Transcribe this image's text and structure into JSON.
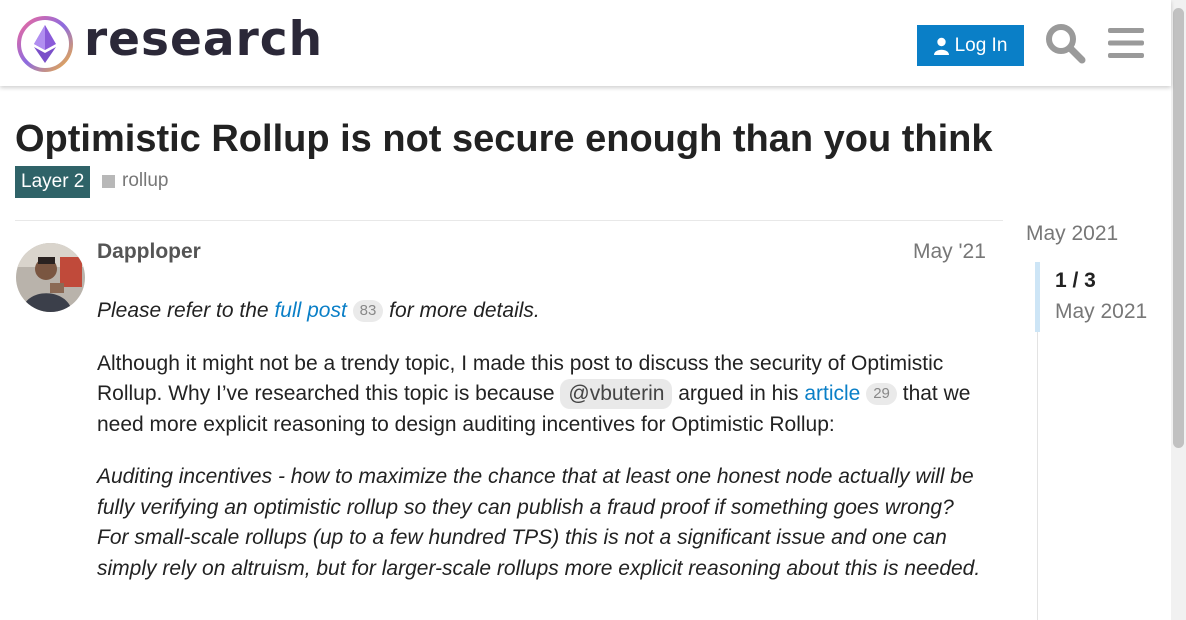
{
  "header": {
    "logo_text": "research",
    "login_label": "Log In",
    "search_icon": "search-icon",
    "menu_icon": "hamburger-menu-icon"
  },
  "topic": {
    "title": "Optimistic Rollup is not secure enough than you think",
    "category": "Layer 2",
    "tag": "rollup"
  },
  "post": {
    "username": "Dapploper",
    "date": "May '21",
    "p1_before": "Please refer to the ",
    "p1_link": "full post",
    "p1_count": "83",
    "p1_after": " for more details.",
    "p2_a": "Although it might not be a trendy topic, I made this post to discuss the security of Optimistic Rollup. Why I’ve researched this topic is because ",
    "p2_mention": "@vbuterin",
    "p2_b": " argued in his ",
    "p2_link": "article",
    "p2_count": "29",
    "p2_c": " that we need more explicit reasoning to design auditing incentives for Optimistic Rollup:",
    "quote": "Auditing incentives - how to maximize the chance that at least one honest node actually will be fully verifying an optimistic rollup so they can publish a fraud proof if something goes wrong? For small-scale rollups (up to a few hundred TPS) this is not a significant issue and one can simply rely on altruism, but for larger-scale rollups more explicit reasoning about this is needed."
  },
  "timeline": {
    "top_date": "May 2021",
    "position": "1 / 3",
    "current_date": "May 2021"
  },
  "colors": {
    "accent": "#0a7fc7",
    "category_bg": "#2f6368"
  }
}
